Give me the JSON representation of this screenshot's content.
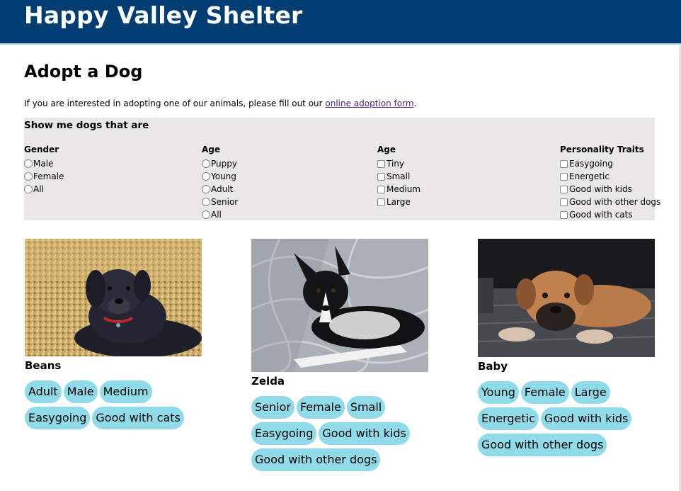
{
  "header": {
    "site_title": "Happy Valley Shelter"
  },
  "page": {
    "title": "Adopt a Dog",
    "intro_prefix": "If you are interested in adopting one of our animals, please fill out our ",
    "intro_link": "online adoption form",
    "intro_suffix": "."
  },
  "filters": {
    "heading": "Show me dogs that are",
    "gender": {
      "title": "Gender",
      "options": [
        "Male",
        "Female",
        "All"
      ]
    },
    "age": {
      "title": "Age",
      "options": [
        "Puppy",
        "Young",
        "Adult",
        "Senior",
        "All"
      ]
    },
    "size": {
      "title": "Age",
      "options": [
        "Tiny",
        "Small",
        "Medium",
        "Large"
      ]
    },
    "personality": {
      "title": "Personality Traits",
      "options": [
        "Easygoing",
        "Energetic",
        "Good with kids",
        "Good with other dogs",
        "Good with cats"
      ]
    }
  },
  "dogs": [
    {
      "name": "Beans",
      "tags": [
        "Adult",
        "Male",
        "Medium",
        "Easygoing",
        "Good with cats"
      ]
    },
    {
      "name": "Zelda",
      "tags": [
        "Senior",
        "Female",
        "Small",
        "Easygoing",
        "Good with kids",
        "Good with other dogs"
      ]
    },
    {
      "name": "Baby",
      "tags": [
        "Young",
        "Female",
        "Large",
        "Energetic",
        "Good with kids",
        "Good with other dogs"
      ]
    }
  ],
  "colors": {
    "header_bg": "#003d73",
    "tag_bg": "#8fdbe9",
    "panel_bg": "#e9e7e8",
    "link": "#4b1f7f"
  }
}
